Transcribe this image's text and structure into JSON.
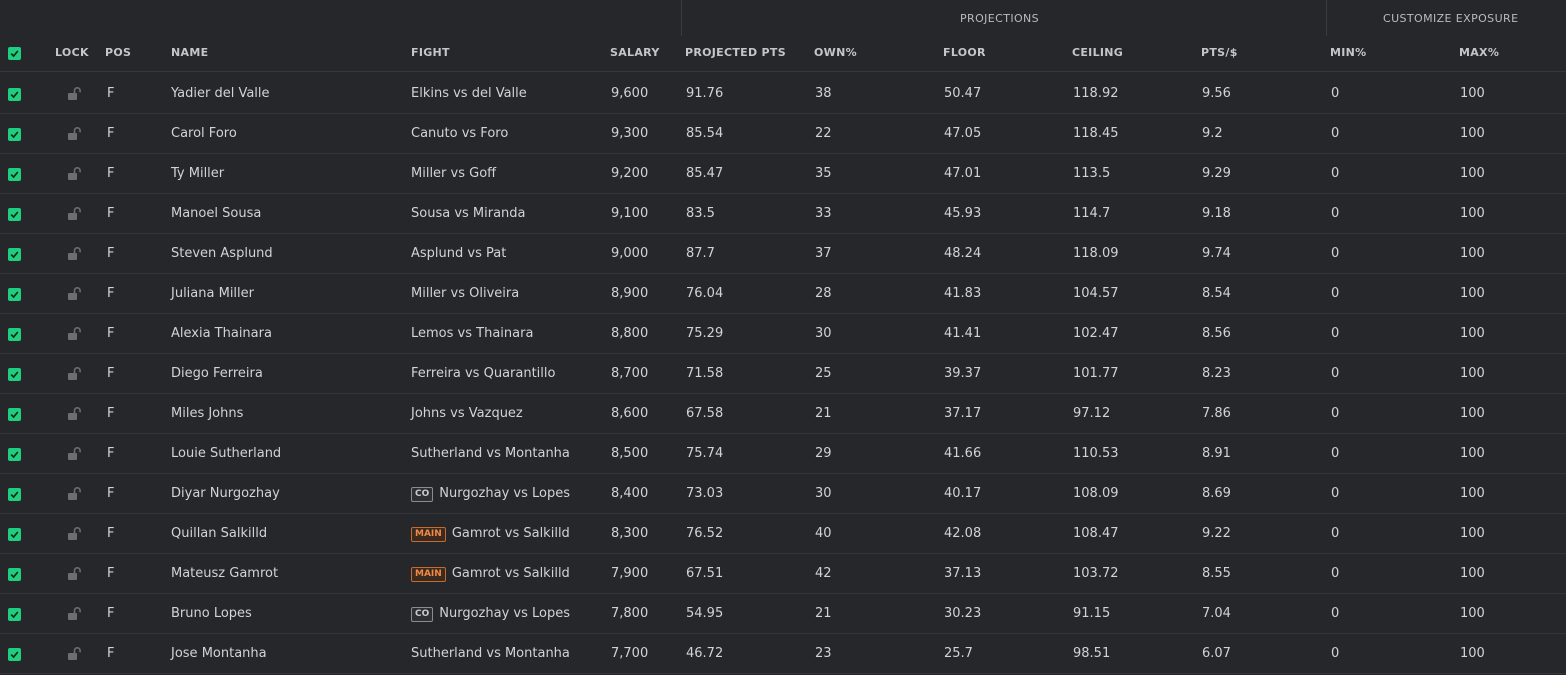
{
  "groups": {
    "projections": "PROJECTIONS",
    "customize_exposure": "CUSTOMIZE EXPOSURE"
  },
  "columns": {
    "lock": "LOCK",
    "pos": "POS",
    "name": "NAME",
    "fight": "FIGHT",
    "salary": "SALARY",
    "projected": "PROJECTED PTS",
    "own": "OWN%",
    "floor": "FLOOR",
    "ceiling": "CEILING",
    "pts_per": "PTS/$",
    "min": "MIN%",
    "max": "MAX%"
  },
  "colors": {
    "accent_green": "#1fce7e",
    "main_badge": "#f08a44",
    "background": "#26272b"
  },
  "rows": [
    {
      "checked": true,
      "pos": "F",
      "name": "Yadier del Valle",
      "badge": "",
      "fight": "Elkins vs del Valle",
      "salary": "9,600",
      "proj": "91.76",
      "own": "38",
      "floor": "50.47",
      "ceiling": "118.92",
      "ptsper": "9.56",
      "min": "0",
      "max": "100"
    },
    {
      "checked": true,
      "pos": "F",
      "name": "Carol Foro",
      "badge": "",
      "fight": "Canuto vs Foro",
      "salary": "9,300",
      "proj": "85.54",
      "own": "22",
      "floor": "47.05",
      "ceiling": "118.45",
      "ptsper": "9.2",
      "min": "0",
      "max": "100"
    },
    {
      "checked": true,
      "pos": "F",
      "name": "Ty Miller",
      "badge": "",
      "fight": "Miller vs Goff",
      "salary": "9,200",
      "proj": "85.47",
      "own": "35",
      "floor": "47.01",
      "ceiling": "113.5",
      "ptsper": "9.29",
      "min": "0",
      "max": "100"
    },
    {
      "checked": true,
      "pos": "F",
      "name": "Manoel Sousa",
      "badge": "",
      "fight": "Sousa vs Miranda",
      "salary": "9,100",
      "proj": "83.5",
      "own": "33",
      "floor": "45.93",
      "ceiling": "114.7",
      "ptsper": "9.18",
      "min": "0",
      "max": "100"
    },
    {
      "checked": true,
      "pos": "F",
      "name": "Steven Asplund",
      "badge": "",
      "fight": "Asplund vs Pat",
      "salary": "9,000",
      "proj": "87.7",
      "own": "37",
      "floor": "48.24",
      "ceiling": "118.09",
      "ptsper": "9.74",
      "min": "0",
      "max": "100"
    },
    {
      "checked": true,
      "pos": "F",
      "name": "Juliana Miller",
      "badge": "",
      "fight": "Miller vs Oliveira",
      "salary": "8,900",
      "proj": "76.04",
      "own": "28",
      "floor": "41.83",
      "ceiling": "104.57",
      "ptsper": "8.54",
      "min": "0",
      "max": "100"
    },
    {
      "checked": true,
      "pos": "F",
      "name": "Alexia Thainara",
      "badge": "",
      "fight": "Lemos vs Thainara",
      "salary": "8,800",
      "proj": "75.29",
      "own": "30",
      "floor": "41.41",
      "ceiling": "102.47",
      "ptsper": "8.56",
      "min": "0",
      "max": "100"
    },
    {
      "checked": true,
      "pos": "F",
      "name": "Diego Ferreira",
      "badge": "",
      "fight": "Ferreira vs Quarantillo",
      "salary": "8,700",
      "proj": "71.58",
      "own": "25",
      "floor": "39.37",
      "ceiling": "101.77",
      "ptsper": "8.23",
      "min": "0",
      "max": "100"
    },
    {
      "checked": true,
      "pos": "F",
      "name": "Miles Johns",
      "badge": "",
      "fight": "Johns vs Vazquez",
      "salary": "8,600",
      "proj": "67.58",
      "own": "21",
      "floor": "37.17",
      "ceiling": "97.12",
      "ptsper": "7.86",
      "min": "0",
      "max": "100"
    },
    {
      "checked": true,
      "pos": "F",
      "name": "Louie Sutherland",
      "badge": "",
      "fight": "Sutherland vs Montanha",
      "salary": "8,500",
      "proj": "75.74",
      "own": "29",
      "floor": "41.66",
      "ceiling": "110.53",
      "ptsper": "8.91",
      "min": "0",
      "max": "100"
    },
    {
      "checked": true,
      "pos": "F",
      "name": "Diyar Nurgozhay",
      "badge": "CO",
      "fight": "Nurgozhay vs Lopes",
      "salary": "8,400",
      "proj": "73.03",
      "own": "30",
      "floor": "40.17",
      "ceiling": "108.09",
      "ptsper": "8.69",
      "min": "0",
      "max": "100"
    },
    {
      "checked": true,
      "pos": "F",
      "name": "Quillan Salkilld",
      "badge": "MAIN",
      "fight": "Gamrot vs Salkilld",
      "salary": "8,300",
      "proj": "76.52",
      "own": "40",
      "floor": "42.08",
      "ceiling": "108.47",
      "ptsper": "9.22",
      "min": "0",
      "max": "100"
    },
    {
      "checked": true,
      "pos": "F",
      "name": "Mateusz Gamrot",
      "badge": "MAIN",
      "fight": "Gamrot vs Salkilld",
      "salary": "7,900",
      "proj": "67.51",
      "own": "42",
      "floor": "37.13",
      "ceiling": "103.72",
      "ptsper": "8.55",
      "min": "0",
      "max": "100"
    },
    {
      "checked": true,
      "pos": "F",
      "name": "Bruno Lopes",
      "badge": "CO",
      "fight": "Nurgozhay vs Lopes",
      "salary": "7,800",
      "proj": "54.95",
      "own": "21",
      "floor": "30.23",
      "ceiling": "91.15",
      "ptsper": "7.04",
      "min": "0",
      "max": "100"
    },
    {
      "checked": true,
      "pos": "F",
      "name": "Jose Montanha",
      "badge": "",
      "fight": "Sutherland vs Montanha",
      "salary": "7,700",
      "proj": "46.72",
      "own": "23",
      "floor": "25.7",
      "ceiling": "98.51",
      "ptsper": "6.07",
      "min": "0",
      "max": "100"
    }
  ]
}
